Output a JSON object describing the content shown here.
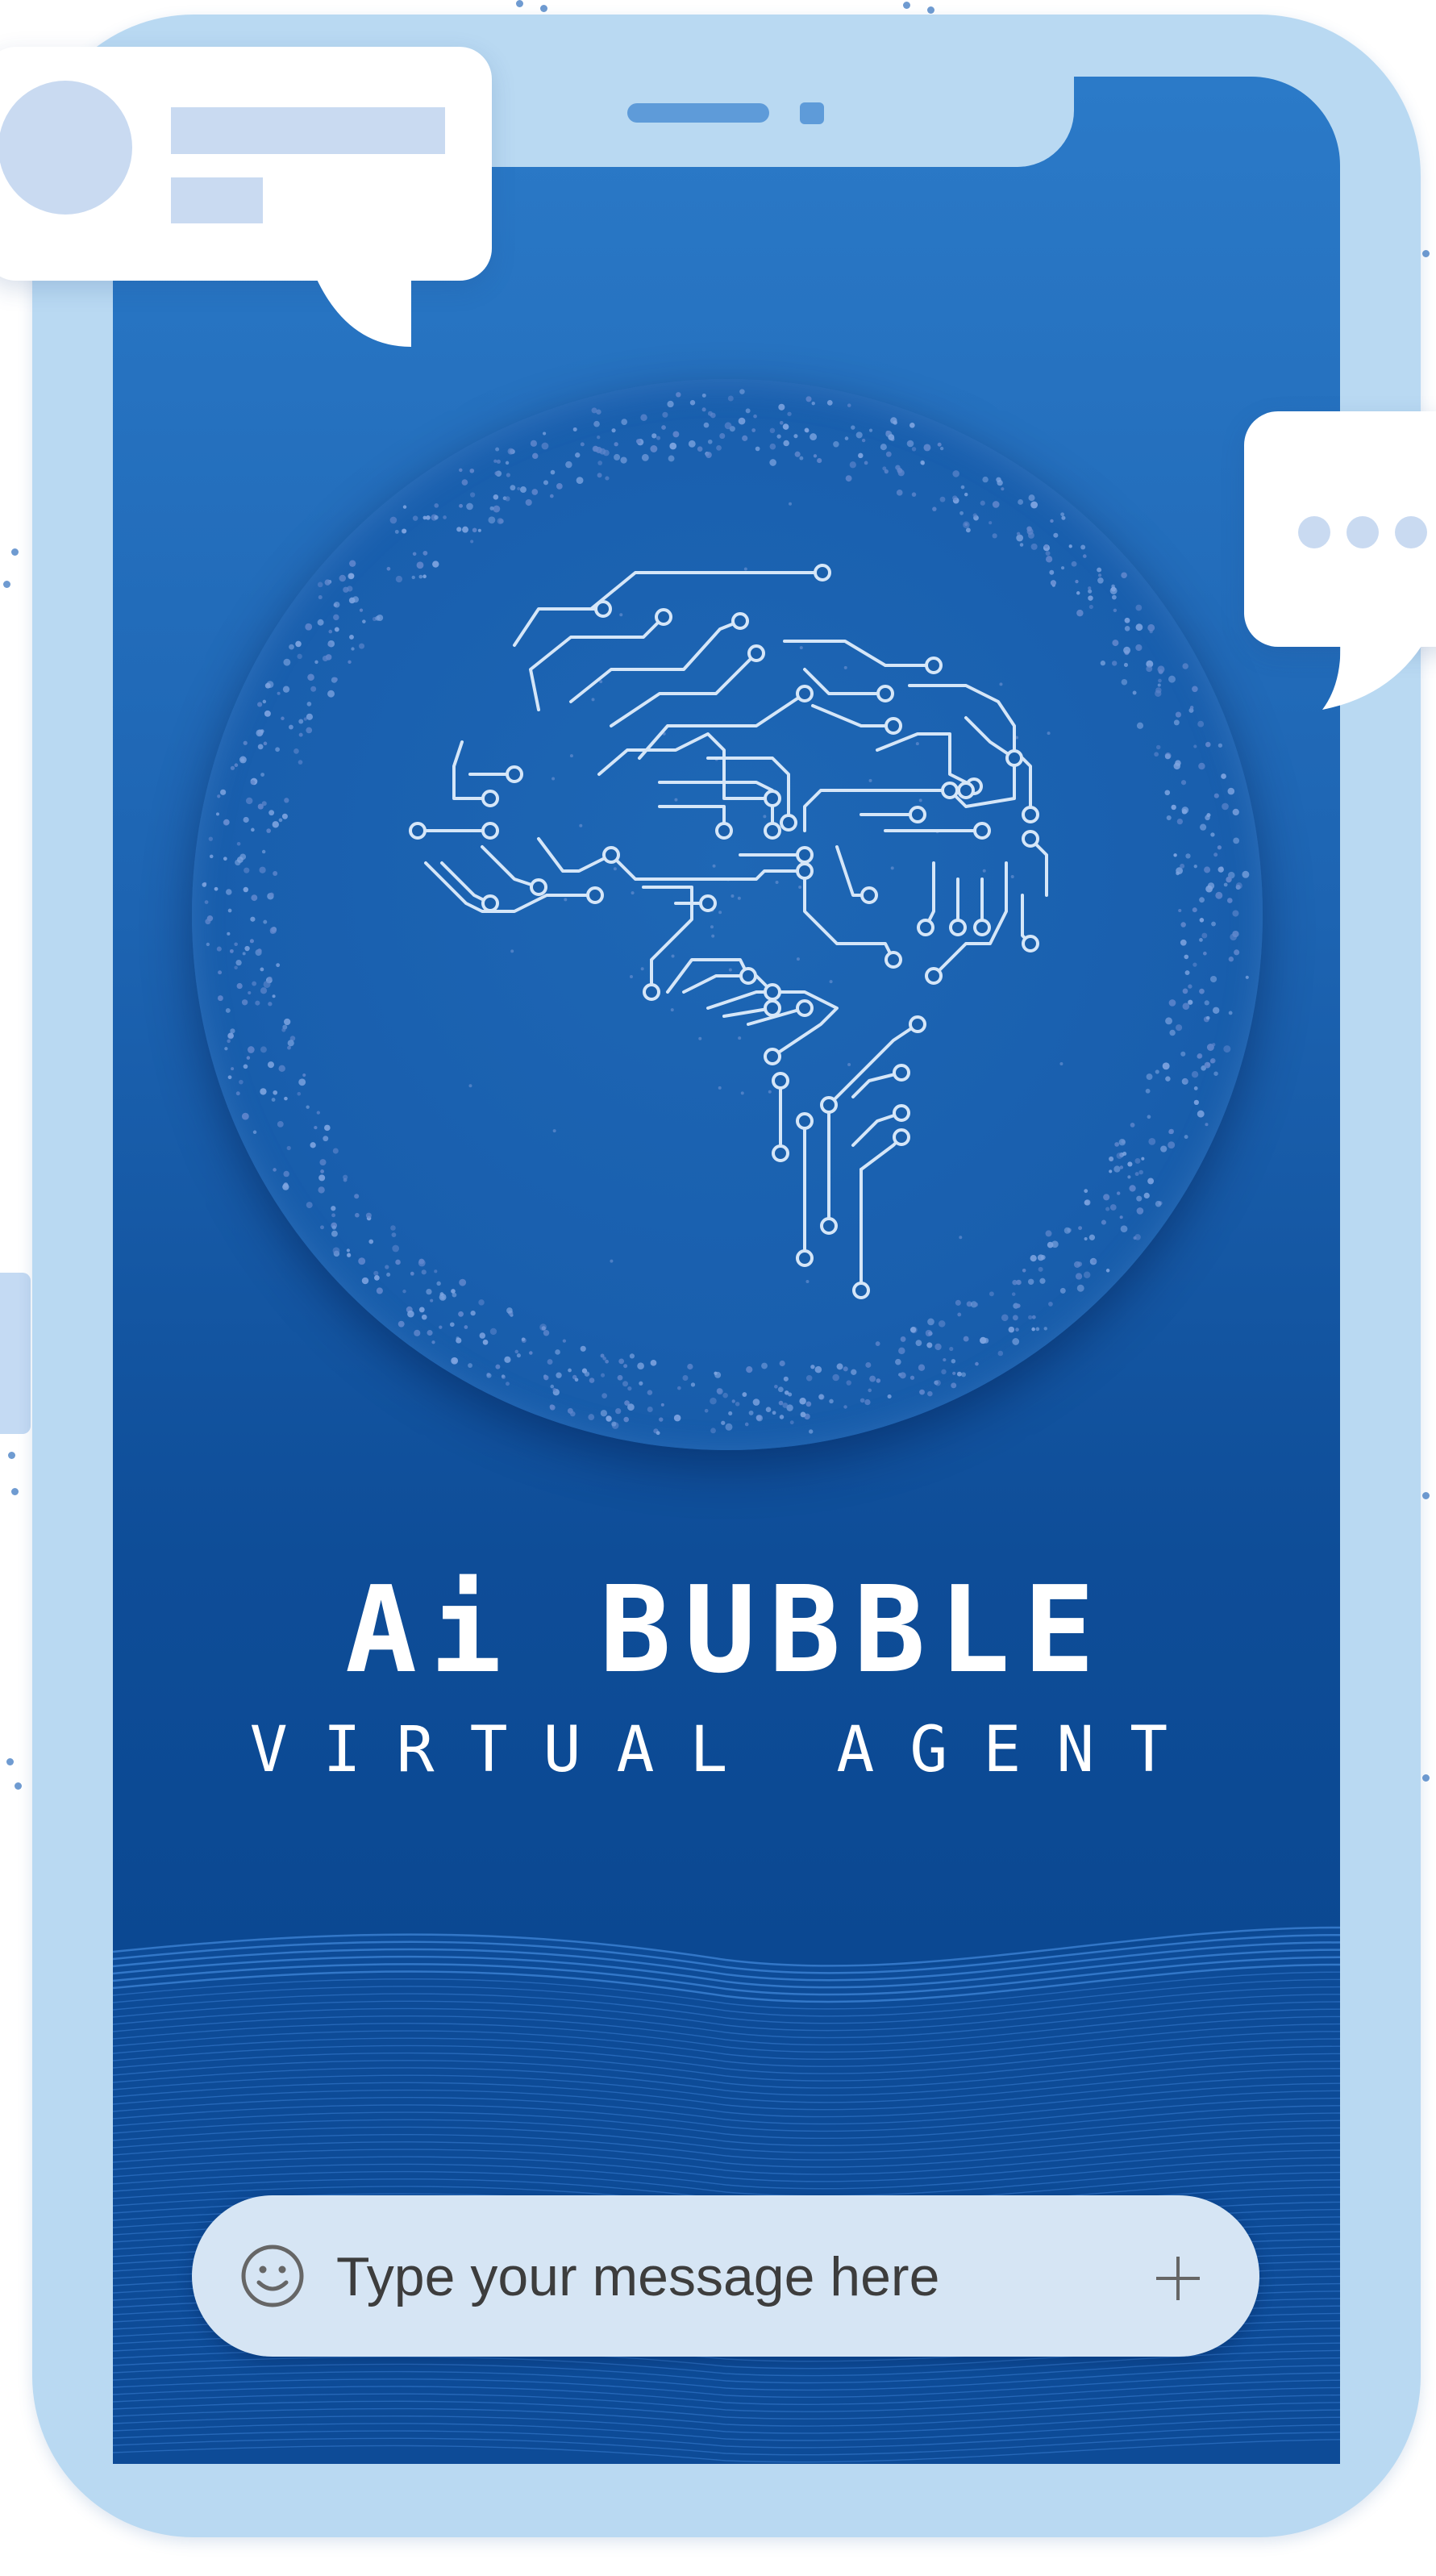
{
  "app": {
    "title": "Ai BUBBLE",
    "subtitle": "VIRTUAL AGENT"
  },
  "composer": {
    "placeholder": "Type your message here",
    "emoji_icon": "smiley-face-icon",
    "add_icon": "plus-icon"
  },
  "chat_bubbles": {
    "left": "message-preview-bubble",
    "right": "typing-indicator-bubble"
  },
  "colors": {
    "phone_frame": "#b9d9f2",
    "screen_top": "#2b7ac8",
    "screen_bottom": "#07428a",
    "input_bar": "#d6e5f4",
    "bubble_placeholder": "#c9daf1"
  }
}
